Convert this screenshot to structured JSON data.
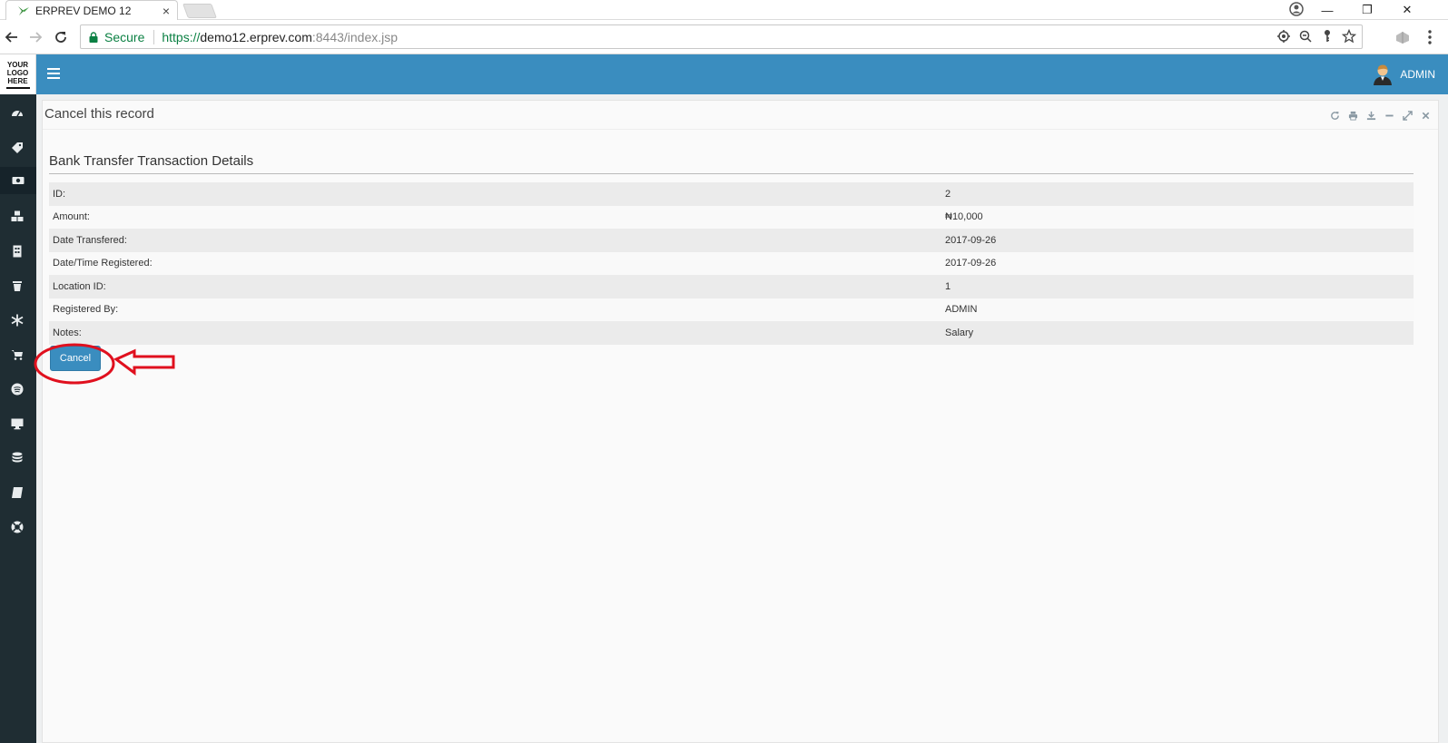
{
  "browser": {
    "tab_title": "ERPREV DEMO 12",
    "tab_close": "×",
    "secure_label": "Secure",
    "url_scheme": "https://",
    "url_host": "demo12.erprev.com",
    "url_path": ":8443/index.jsp",
    "minimize": "—",
    "restore": "❐",
    "close": "✕"
  },
  "sidebar": {
    "logo_lines": [
      "YOUR",
      "LOGO",
      "HERE"
    ],
    "items": [
      {
        "name": "dashboard-icon"
      },
      {
        "name": "tag-icon"
      },
      {
        "name": "money-icon",
        "active": true
      },
      {
        "name": "cubes-icon"
      },
      {
        "name": "building-icon"
      },
      {
        "name": "trash-icon"
      },
      {
        "name": "snowflake-icon"
      },
      {
        "name": "cart-icon"
      },
      {
        "name": "spotify-icon"
      },
      {
        "name": "desktop-icon"
      },
      {
        "name": "database-icon"
      },
      {
        "name": "book-icon"
      },
      {
        "name": "lifesaver-icon"
      }
    ]
  },
  "topbar": {
    "user_name": "ADMIN",
    "accent": "#3a8dbf"
  },
  "panel": {
    "title": "Cancel this record",
    "section_title": "Bank Transfer Transaction Details",
    "rows": [
      {
        "label": "ID:",
        "value": "2"
      },
      {
        "label": "Amount:",
        "value": "₦10,000"
      },
      {
        "label": "Date Transfered:",
        "value": "2017-09-26"
      },
      {
        "label": "Date/Time Registered:",
        "value": "2017-09-26"
      },
      {
        "label": "Location ID:",
        "value": "1"
      },
      {
        "label": "Registered By:",
        "value": "ADMIN"
      },
      {
        "label": "Notes:",
        "value": "Salary"
      }
    ],
    "cancel_label": "Cancel"
  },
  "annotation_color": "#e0101e"
}
